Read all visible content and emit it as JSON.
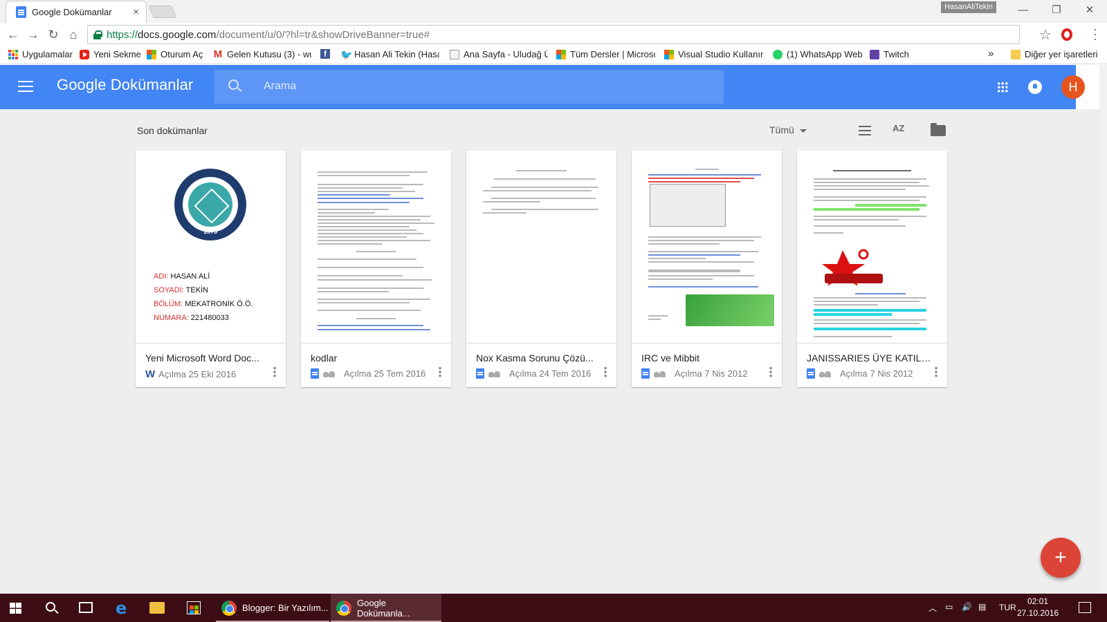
{
  "browser": {
    "tab_title": "Google Dokümanlar",
    "tab_close": "×",
    "user_chip": "HasanAliTekin",
    "window_controls": {
      "minimize": "—",
      "restore": "❐",
      "close": "✕"
    },
    "nav": {
      "back": "←",
      "forward": "→",
      "reload": "↻",
      "home": "⌂"
    },
    "url": {
      "scheme": "https://",
      "host": "docs.google.com",
      "path": "/document/u/0/?hl=tr&showDriveBanner=true#"
    },
    "star": "☆",
    "bookmarks": [
      {
        "label": "Uygulamalar",
        "icon": "apps-icon"
      },
      {
        "label": "Yeni Sekme",
        "icon": "youtube-icon"
      },
      {
        "label": "Oturum Aç",
        "icon": "microsoft-icon"
      },
      {
        "label": "Gelen Kutusu (3) - wu",
        "icon": "gmail-icon"
      },
      {
        "label": "",
        "icon": "facebook-icon"
      },
      {
        "label": "Hasan Ali Tekin (Hasar",
        "icon": "twitter-icon"
      },
      {
        "label": "Ana Sayfa - Uludağ Ü",
        "icon": "page-icon"
      },
      {
        "label": "Tüm Dersler | Microso",
        "icon": "microsoft-icon"
      },
      {
        "label": "Visual Studio Kullanım",
        "icon": "microsoft-icon"
      },
      {
        "label": "(1) WhatsApp Web",
        "icon": "whatsapp-icon"
      },
      {
        "label": "Twitch",
        "icon": "twitch-icon"
      }
    ],
    "bookmarks_overflow": "»",
    "other_bookmarks": "Diğer yer işaretleri"
  },
  "app": {
    "brand": "Google Dokümanlar",
    "search_placeholder": "Arama",
    "avatar_letter": "H"
  },
  "main": {
    "section_title": "Son dokümanlar",
    "filter_label": "Tümü",
    "sort_label": "AZ",
    "fab_label": "+"
  },
  "documents": [
    {
      "title": "Yeni Microsoft Word Doc...",
      "opened_label": "Açılma",
      "date": "25 Eki 2016",
      "type": "word",
      "shared": false
    },
    {
      "title": "kodlar",
      "opened_label": "Açılma",
      "date": "25 Tem 2016",
      "type": "docs",
      "shared": true
    },
    {
      "title": "Nox Kasma Sorunu Çözü...",
      "opened_label": "Açılma",
      "date": "24 Tem 2016",
      "type": "docs",
      "shared": true
    },
    {
      "title": "IRC ve Mibbit",
      "opened_label": "Açılma",
      "date": "7 Nis 2012",
      "type": "docs",
      "shared": true
    },
    {
      "title": "JANISSARIES ÜYE KATILI...",
      "opened_label": "Açılma",
      "date": "7 Nis 2012",
      "type": "docs",
      "shared": true
    }
  ],
  "thumbnail_1": {
    "seal_year": "1975",
    "rows": [
      {
        "label": "ADI:",
        "value": "HASAN ALİ"
      },
      {
        "label": "SOYADI:",
        "value": "TEKİN"
      },
      {
        "label": "BÖLÜM:",
        "value": "MEKATRONİK Ö.Ö."
      },
      {
        "label": "NUMARA:",
        "value": "221480033"
      }
    ]
  },
  "taskbar": {
    "apps": [
      {
        "label": "Blogger: Bir Yazılım...",
        "active": false
      },
      {
        "label": "Google Dokümanla...",
        "active": true
      }
    ],
    "language": "TUR",
    "time": "02:01",
    "date": "27.10.2016"
  },
  "colors": {
    "appbar": "#4285f4",
    "fab": "#db4437",
    "avatar": "#e8541e",
    "taskbar": "#3c0d14"
  }
}
